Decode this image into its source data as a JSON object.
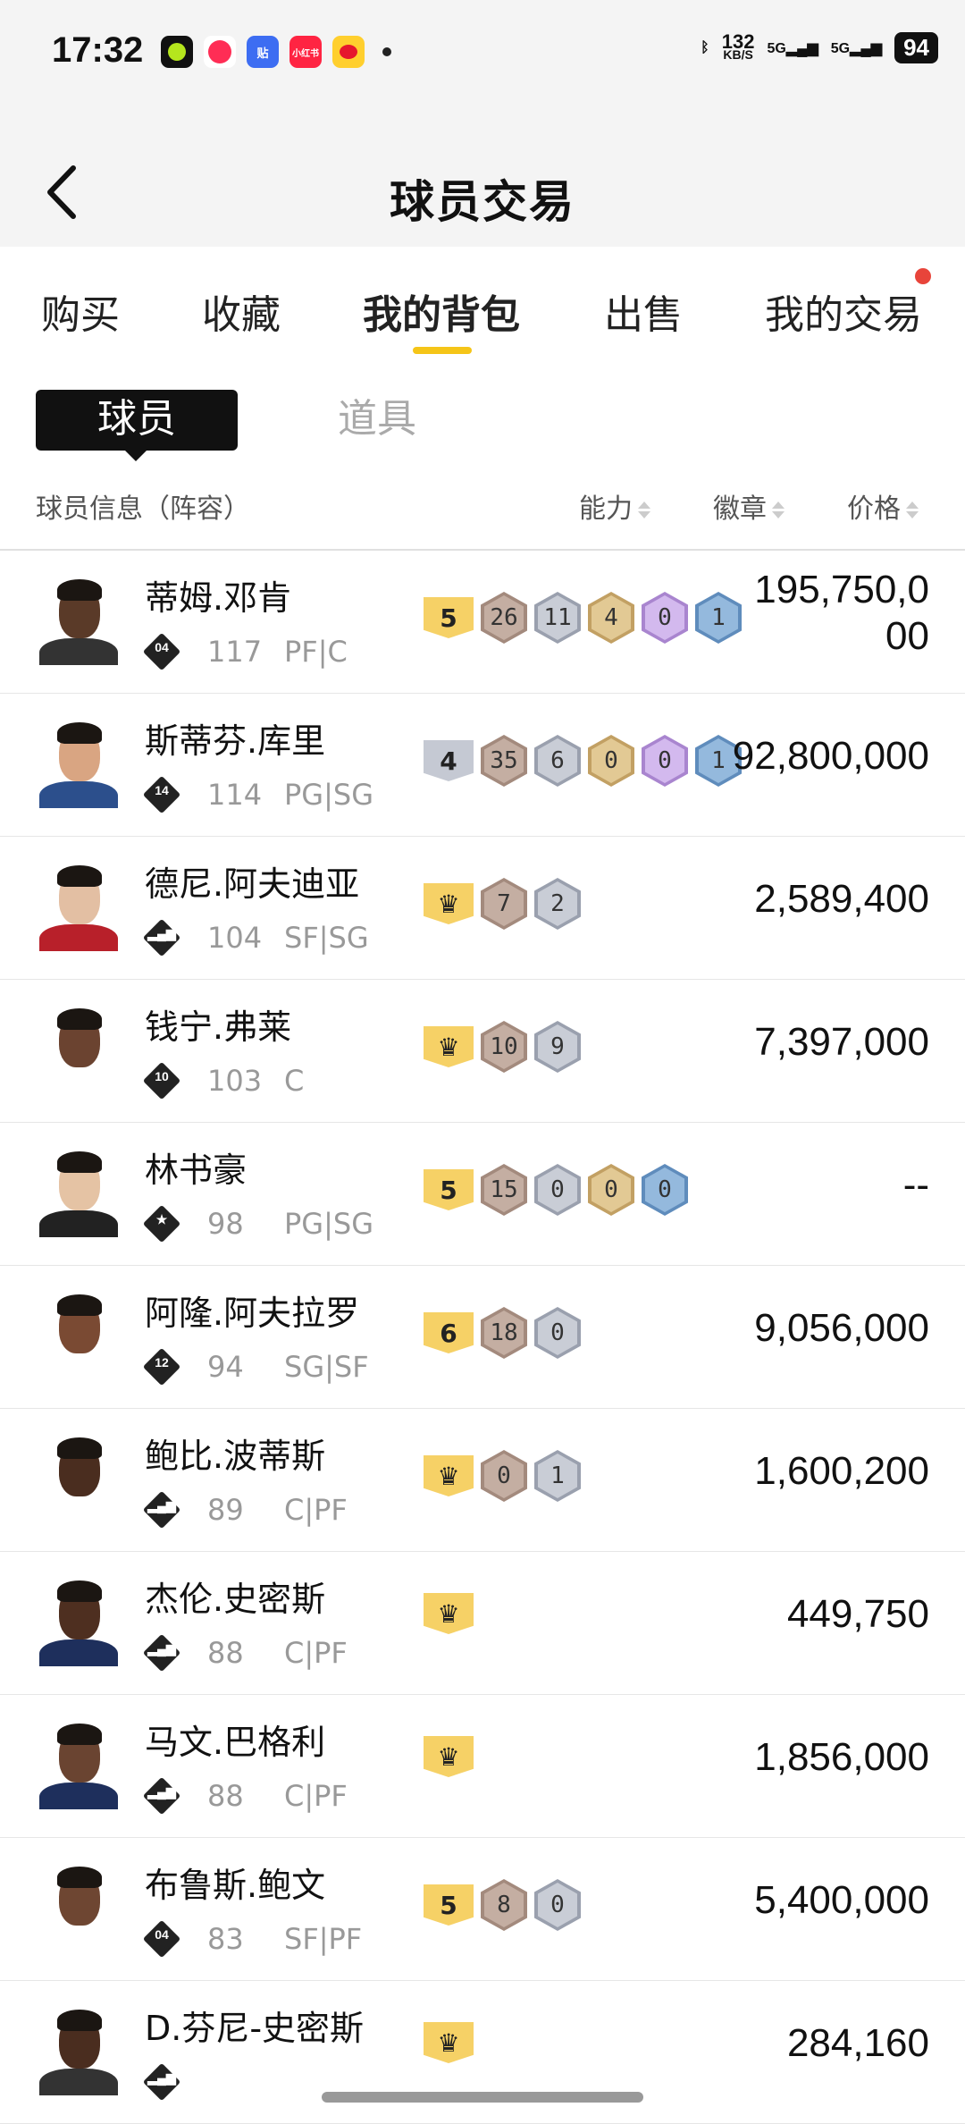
{
  "status": {
    "time": "17:32",
    "apps": [
      "app1",
      "app2",
      "贴",
      "小红书",
      "微博"
    ],
    "net_speed_value": "132",
    "net_speed_unit": "KB/S",
    "signal_1": "5G",
    "signal_2": "5G",
    "battery": "94"
  },
  "header": {
    "title": "球员交易"
  },
  "tabs": [
    {
      "label": "购买"
    },
    {
      "label": "收藏"
    },
    {
      "label": "我的背包"
    },
    {
      "label": "出售"
    },
    {
      "label": "我的交易"
    }
  ],
  "segments": {
    "players": "球员",
    "items": "道具"
  },
  "columns": {
    "info": "球员信息（阵容）",
    "ability": "能力",
    "badge": "徽章",
    "price": "价格"
  },
  "colors": {
    "accent": "#f5c518",
    "level": "#f6d166",
    "bronze": "#b79f92",
    "silver": "#bcc1cc",
    "gold": "#d8b97d",
    "purple": "#c3a3e0",
    "blue": "#7ea6cf"
  },
  "players": [
    {
      "name": "蒂姆.邓肯",
      "tier": "04",
      "ovr": "117",
      "pos": "PF|C",
      "level": "5",
      "level_color": "#f6d166",
      "badges": [
        {
          "v": "26",
          "type": "bronze"
        },
        {
          "v": "11",
          "type": "silver"
        },
        {
          "v": "4",
          "type": "gold"
        },
        {
          "v": "0",
          "type": "purple"
        },
        {
          "v": "1",
          "type": "blue"
        }
      ],
      "price": "195,750,000",
      "skin": "#5a3a28",
      "jersey": "#333"
    },
    {
      "name": "斯蒂芬.库里",
      "tier": "14",
      "ovr": "114",
      "pos": "PG|SG",
      "level": "4",
      "level_color": "#c5c9d3",
      "badges": [
        {
          "v": "35",
          "type": "bronze"
        },
        {
          "v": "6",
          "type": "silver"
        },
        {
          "v": "0",
          "type": "gold"
        },
        {
          "v": "0",
          "type": "purple"
        },
        {
          "v": "1",
          "type": "blue"
        }
      ],
      "price": "92,800,000",
      "skin": "#d9a582",
      "jersey": "#2c4f8c"
    },
    {
      "name": "德尼.阿夫迪亚",
      "tier": "",
      "ovr": "104",
      "pos": "SF|SG",
      "level": "♛",
      "level_color": "#f6d166",
      "badges": [
        {
          "v": "7",
          "type": "bronze"
        },
        {
          "v": "2",
          "type": "silver"
        }
      ],
      "price": "2,589,400",
      "skin": "#e3bfa3",
      "jersey": "#b8202a"
    },
    {
      "name": "钱宁.弗莱",
      "tier": "10",
      "ovr": "103",
      "pos": "C",
      "level": "♛",
      "level_color": "#f6d166",
      "badges": [
        {
          "v": "10",
          "type": "bronze"
        },
        {
          "v": "9",
          "type": "silver"
        }
      ],
      "price": "7,397,000",
      "skin": "#6b4330",
      "jersey": "#ffffff"
    },
    {
      "name": "林书豪",
      "tier": "★",
      "ovr": "98",
      "pos": "PG|SG",
      "level": "5",
      "level_color": "#f6d166",
      "badges": [
        {
          "v": "15",
          "type": "bronze"
        },
        {
          "v": "0",
          "type": "silver"
        },
        {
          "v": "0",
          "type": "gold"
        },
        {
          "v": "0",
          "type": "blue"
        }
      ],
      "price": "--",
      "skin": "#e5c3a4",
      "jersey": "#222"
    },
    {
      "name": "阿隆.阿夫拉罗",
      "tier": "12",
      "ovr": "94",
      "pos": "SG|SF",
      "level": "6",
      "level_color": "#f6d166",
      "badges": [
        {
          "v": "18",
          "type": "bronze"
        },
        {
          "v": "0",
          "type": "silver"
        }
      ],
      "price": "9,056,000",
      "skin": "#7a4a33",
      "jersey": "#ffffff"
    },
    {
      "name": "鲍比.波蒂斯",
      "tier": "",
      "ovr": "89",
      "pos": "C|PF",
      "level": "♛",
      "level_color": "#f6d166",
      "badges": [
        {
          "v": "0",
          "type": "bronze"
        },
        {
          "v": "1",
          "type": "silver"
        }
      ],
      "price": "1,600,200",
      "skin": "#4a2d1f",
      "jersey": "#ffffff"
    },
    {
      "name": "杰伦.史密斯",
      "tier": "",
      "ovr": "88",
      "pos": "C|PF",
      "level": "♛",
      "level_color": "#f6d166",
      "badges": [],
      "price": "449,750",
      "skin": "#4e2f20",
      "jersey": "#1e2f5c"
    },
    {
      "name": "马文.巴格利",
      "tier": "",
      "ovr": "88",
      "pos": "C|PF",
      "level": "♛",
      "level_color": "#f6d166",
      "badges": [],
      "price": "1,856,000",
      "skin": "#6a4431",
      "jersey": "#1e2f5c"
    },
    {
      "name": "布鲁斯.鲍文",
      "tier": "04",
      "ovr": "83",
      "pos": "SF|PF",
      "level": "5",
      "level_color": "#f6d166",
      "badges": [
        {
          "v": "8",
          "type": "bronze"
        },
        {
          "v": "0",
          "type": "silver"
        }
      ],
      "price": "5,400,000",
      "skin": "#6e4632",
      "jersey": "#ffffff"
    },
    {
      "name": "D.芬尼-史密斯",
      "tier": "",
      "ovr": "",
      "pos": "",
      "level": "♛",
      "level_color": "#f6d166",
      "badges": [],
      "price": "284,160",
      "skin": "#4a2d1f",
      "jersey": "#333"
    }
  ]
}
